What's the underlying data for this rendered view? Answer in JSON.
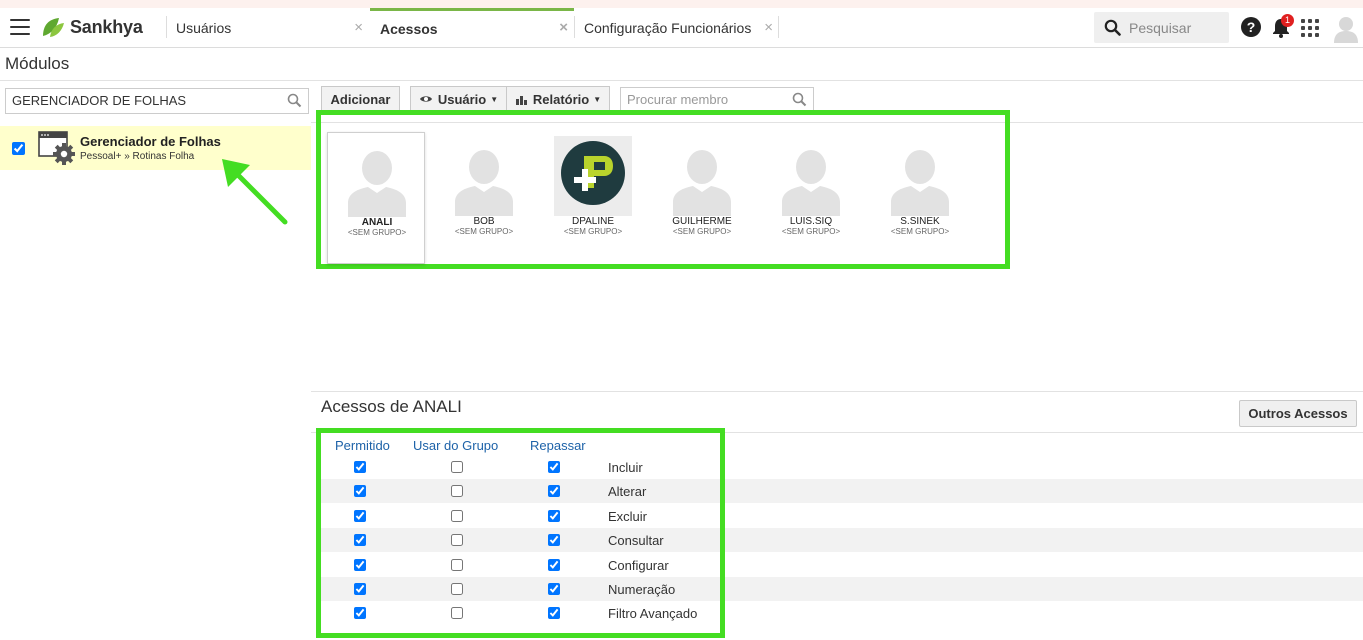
{
  "topbar": {
    "brand": "Sankhya",
    "tabs": [
      {
        "label": "Usuários",
        "active": false
      },
      {
        "label": "Acessos",
        "active": true
      },
      {
        "label": "Configuração Funcionários",
        "active": false
      }
    ],
    "close_glyph": "×",
    "search_placeholder": "Pesquisar",
    "notification_count": "1",
    "help_glyph": "?"
  },
  "modules_panel": {
    "title": "Módulos",
    "search_value": "GERENCIADOR DE FOLHAS",
    "items": [
      {
        "name": "Gerenciador de Folhas",
        "path": "Pessoal+ » Rotinas Folha",
        "checked": true,
        "icon": "window-gear-icon"
      }
    ]
  },
  "toolbar": {
    "add_label": "Adicionar",
    "user_label": "Usuário",
    "report_label": "Relatório",
    "member_search_placeholder": "Procurar membro"
  },
  "members": [
    {
      "name": "ANALI",
      "group": "<SEM GRUPO>",
      "selected": true,
      "avatar": "default-avatar-icon"
    },
    {
      "name": "BOB",
      "group": "<SEM GRUPO>",
      "selected": false,
      "avatar": "default-avatar-icon"
    },
    {
      "name": "DPALINE",
      "group": "<SEM GRUPO>",
      "selected": false,
      "avatar": "custom-logo-avatar"
    },
    {
      "name": "GUILHERME",
      "group": "<SEM GRUPO>",
      "selected": false,
      "avatar": "default-avatar-icon"
    },
    {
      "name": "LUIS.SIQ",
      "group": "<SEM GRUPO>",
      "selected": false,
      "avatar": "default-avatar-icon"
    },
    {
      "name": "S.SINEK",
      "group": "<SEM GRUPO>",
      "selected": false,
      "avatar": "default-avatar-icon"
    }
  ],
  "access": {
    "title": "Acessos de ANALI",
    "other_access_label": "Outros Acessos",
    "columns": [
      "Permitido",
      "Usar do Grupo",
      "Repassar"
    ],
    "rows": [
      {
        "label": "Incluir",
        "permitido": true,
        "usar_grupo": false,
        "repassar": true
      },
      {
        "label": "Alterar",
        "permitido": true,
        "usar_grupo": false,
        "repassar": true
      },
      {
        "label": "Excluir",
        "permitido": true,
        "usar_grupo": false,
        "repassar": true
      },
      {
        "label": "Consultar",
        "permitido": true,
        "usar_grupo": false,
        "repassar": true
      },
      {
        "label": "Configurar",
        "permitido": true,
        "usar_grupo": false,
        "repassar": true
      },
      {
        "label": "Numeração",
        "permitido": true,
        "usar_grupo": false,
        "repassar": true
      },
      {
        "label": "Filtro Avançado",
        "permitido": true,
        "usar_grupo": false,
        "repassar": true
      }
    ]
  },
  "colors": {
    "highlight_green": "#44dd22",
    "tab_accent": "#7ab648",
    "module_selected_bg": "#ffffcc",
    "column_header_blue": "#1d62a8"
  }
}
